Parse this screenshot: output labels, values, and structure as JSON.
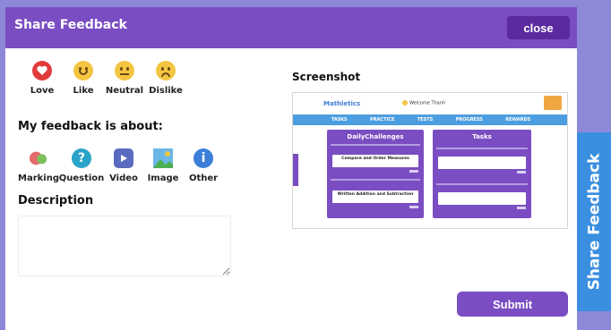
{
  "modal": {
    "title": "Share Feedback",
    "close_label": "close",
    "submit_label": "Submit"
  },
  "reactions": [
    {
      "label": "Love",
      "icon": "heart-icon"
    },
    {
      "label": "Like",
      "icon": "smile-face-icon"
    },
    {
      "label": "Neutral",
      "icon": "neutral-face-icon"
    },
    {
      "label": "Dislike",
      "icon": "frown-face-icon"
    }
  ],
  "about": {
    "heading": "My feedback is about:",
    "items": [
      {
        "label": "Marking",
        "icon": "marking-icon"
      },
      {
        "label": "Question",
        "icon": "question-icon"
      },
      {
        "label": "Video",
        "icon": "video-icon"
      },
      {
        "label": "Image",
        "icon": "image-icon"
      },
      {
        "label": "Other",
        "icon": "info-icon"
      }
    ]
  },
  "description": {
    "heading": "Description",
    "value": ""
  },
  "screenshot": {
    "heading": "Screenshot",
    "logo": "Mathletics",
    "welcome": "Welcome Thanh",
    "nav": [
      "TASKS",
      "PRACTICE",
      "TESTS",
      "PROGRESS",
      "REWARDS"
    ],
    "daily_title": "DailyChallenges",
    "tasks_title": "Tasks",
    "card1": "Compare and Order Measures",
    "card2": "Written Addition and Subtraction"
  },
  "side_tab": {
    "label": "Share Feedback"
  },
  "colors": {
    "primary": "#7b4dc2",
    "accent_blue": "#3b8fe0",
    "overlay": "#8e88d8"
  }
}
